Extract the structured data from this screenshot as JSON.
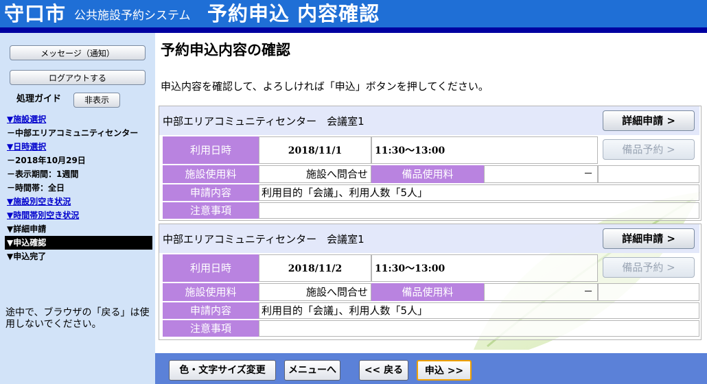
{
  "header": {
    "city": "守口市",
    "system": "公共施設予約システム",
    "page": "予約申込 内容確認"
  },
  "sidebar": {
    "message_button": "メッセージ（通知）",
    "logout_button": "ログアウトする",
    "guide_label": "処理ガイド",
    "guide_toggle": "非表示",
    "steps": [
      "▼施設選択",
      "－中部エリアコミュニティセンター",
      "▼日時選択",
      "－2018年10月29日",
      "－表示期間：1週間",
      "－時間帯：全日",
      "▼施設別空き状況",
      "▼時間帯別空き状況",
      "▼詳細申請",
      "▼申込確認",
      "▼申込完了"
    ],
    "note": "途中で、ブラウザの「戻る」は使用しないでください。"
  },
  "main": {
    "title": "予約申込内容の確認",
    "instruction": "申込内容を確認して、よろしければ「申込」ボタンを押してください。",
    "labels": {
      "datetime": "利用日時",
      "facility_fee": "施設使用料",
      "equipment_fee": "備品使用料",
      "content": "申請内容",
      "notes": "注意事項"
    },
    "detail_button": "詳細申請 >",
    "equipment_button": "備品予約 >",
    "reservations": [
      {
        "facility": "中部エリアコミュニティセンター　会議室1",
        "date": "2018/11/1",
        "time": "11:30～13:00",
        "facility_fee": "施設へ問合せ",
        "equipment_fee": "－",
        "content": "利用目的「会議」、利用人数「5人」",
        "notes": ""
      },
      {
        "facility": "中部エリアコミュニティセンター　会議室1",
        "date": "2018/11/2",
        "time": "11:30～13:00",
        "facility_fee": "施設へ問合せ",
        "equipment_fee": "－",
        "content": "利用目的「会議」、利用人数「5人」",
        "notes": ""
      }
    ]
  },
  "footer": {
    "style_button": "色・文字サイズ変更",
    "menu_button": "メニューへ",
    "back_button": "<< 戻る",
    "apply_button": "申込 >>"
  },
  "colors": {
    "header": "#1f6fd6",
    "header_bar": "#0000a0",
    "sidebar": "#d2e3f8",
    "label": "#b983e0",
    "footer": "#5b81d8",
    "row_header": "#e2e7fa"
  }
}
